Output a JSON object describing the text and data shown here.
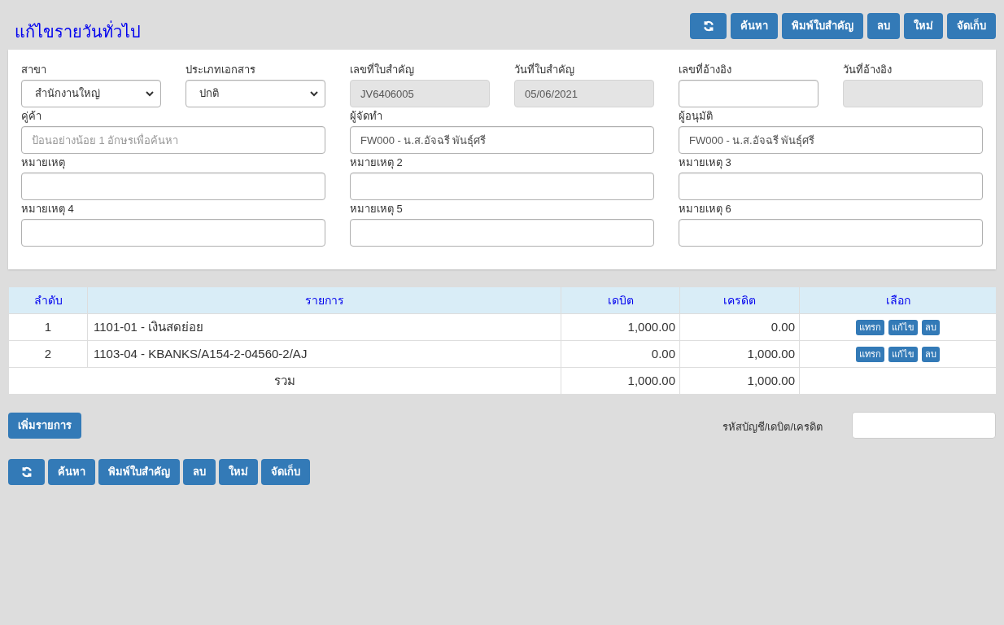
{
  "title": "แก้ไขรายวันทั่วไป",
  "toolbar_top": [
    {
      "kind": "icon"
    },
    {
      "kind": "text",
      "label": "ค้นหา"
    },
    {
      "kind": "text",
      "label": "พิมพ์ใบสำคัญ"
    },
    {
      "kind": "text",
      "label": "ลบ"
    },
    {
      "kind": "text",
      "label": "ใหม่"
    },
    {
      "kind": "text",
      "label": "จัดเก็บ"
    }
  ],
  "form": {
    "fields": [
      {
        "label": "สาขา",
        "kind": "select",
        "wide": false,
        "disabled": false,
        "value": "สำนักงานใหญ่"
      },
      {
        "label": "ประเภทเอกสาร",
        "kind": "select",
        "wide": false,
        "disabled": false,
        "value": "ปกติ"
      },
      {
        "label": "เลขที่ใบสำคัญ",
        "kind": "input",
        "wide": false,
        "disabled": true,
        "value": "JV6406005"
      },
      {
        "label": "วันที่ใบสำคัญ",
        "kind": "input",
        "wide": false,
        "disabled": true,
        "value": "05/06/2021"
      },
      {
        "label": "เลขที่อ้างอิง",
        "kind": "input",
        "wide": false,
        "disabled": false
      },
      {
        "label": "วันที่อ้างอิง",
        "kind": "input",
        "wide": false,
        "disabled": true
      },
      {
        "label": "คู่ค้า",
        "kind": "input",
        "wide": true,
        "disabled": false,
        "placeholder": "ป้อนอย่างน้อย 1 อักษรเพื่อค้นหา"
      },
      {
        "label": "ผู้จัดทำ",
        "kind": "input",
        "wide": true,
        "disabled": false,
        "value": "FW000 - น.ส.อัจฉรี พันธุ์ศรี"
      },
      {
        "label": "ผู้อนุมัติ",
        "kind": "input",
        "wide": true,
        "disabled": false,
        "value": "FW000 - น.ส.อัจฉรี พันธุ์ศรี"
      },
      {
        "label": "หมายเหตุ",
        "kind": "input",
        "wide": true,
        "disabled": false
      },
      {
        "label": "หมายเหตุ 2",
        "kind": "input",
        "wide": true,
        "disabled": false
      },
      {
        "label": "หมายเหตุ 3",
        "kind": "input",
        "wide": true,
        "disabled": false
      },
      {
        "label": "หมายเหตุ 4",
        "kind": "input",
        "wide": true,
        "disabled": false
      },
      {
        "label": "หมายเหตุ 5",
        "kind": "input",
        "wide": true,
        "disabled": false
      },
      {
        "label": "หมายเหตุ 6",
        "kind": "input",
        "wide": true,
        "disabled": false
      }
    ]
  },
  "table": {
    "columns": [
      "ลำดับ",
      "รายการ",
      "เดบิต",
      "เครดิต",
      "เลือก"
    ],
    "rows": [
      {
        "no": "1",
        "item": "1101-01 - เงินสดย่อย",
        "debit": "1,000.00",
        "credit": "0.00",
        "actions": [
          "แทรก",
          "แก้ไข",
          "ลบ"
        ]
      },
      {
        "no": "2",
        "item": "1103-04 - KBANKS/A154-2-04560-2/AJ",
        "debit": "0.00",
        "credit": "1,000.00",
        "actions": [
          "แทรก",
          "แก้ไข",
          "ลบ"
        ]
      }
    ],
    "total": {
      "label": "รวม",
      "debit": "1,000.00",
      "credit": "1,000.00"
    }
  },
  "add_button": "เพิ่มรายการ",
  "account_field": {
    "label": "รหัสบัญชี/เดบิต/เครดิต"
  },
  "toolbar_bottom": [
    {
      "kind": "icon"
    },
    {
      "kind": "text",
      "label": "ค้นหา"
    },
    {
      "kind": "text",
      "label": "พิมพ์ใบสำคัญ"
    },
    {
      "kind": "text",
      "label": "ลบ"
    },
    {
      "kind": "text",
      "label": "ใหม่"
    },
    {
      "kind": "text",
      "label": "จัดเก็บ"
    }
  ]
}
